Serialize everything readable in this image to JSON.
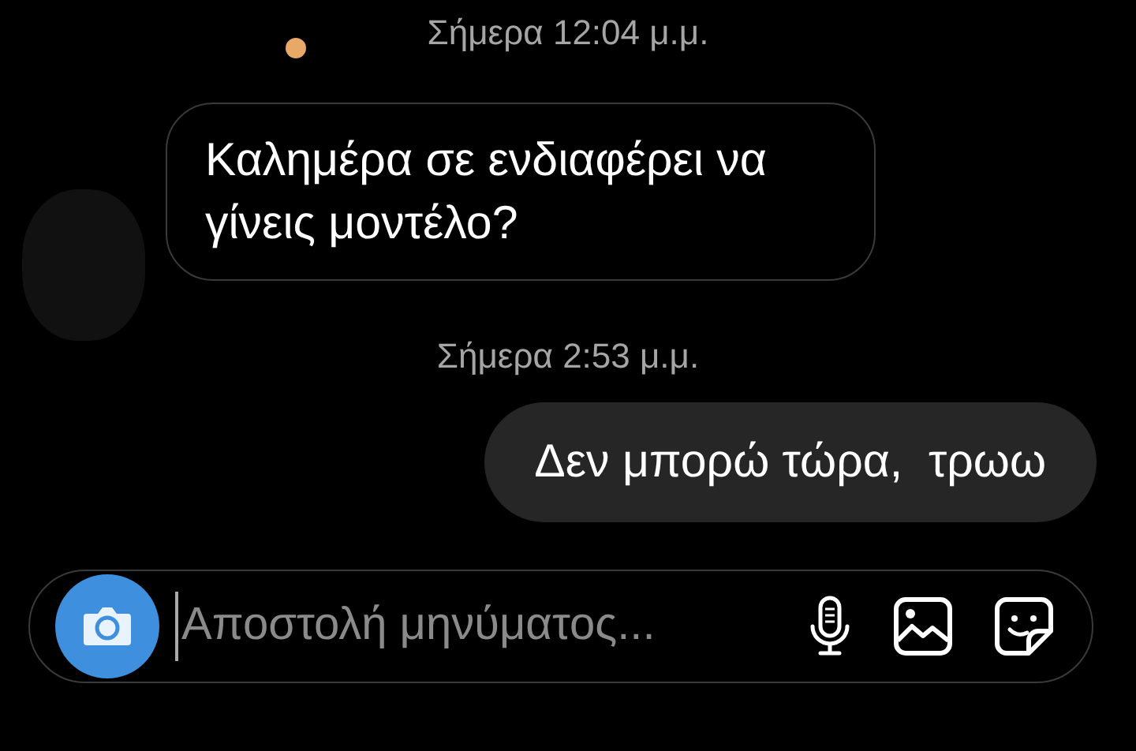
{
  "messages": [
    {
      "kind": "timestamp",
      "text": "Σήμερα 12:04 μ.μ."
    },
    {
      "kind": "incoming",
      "text": "Καλημέρα σε ενδιαφέρει να γίνεις μοντέλο?"
    },
    {
      "kind": "timestamp",
      "text": "Σήμερα 2:53 μ.μ."
    },
    {
      "kind": "outgoing",
      "text": "Δεν μπορώ τώρα,  τρωω"
    }
  ],
  "composer": {
    "placeholder": "Αποστολή μηνύματος..."
  }
}
